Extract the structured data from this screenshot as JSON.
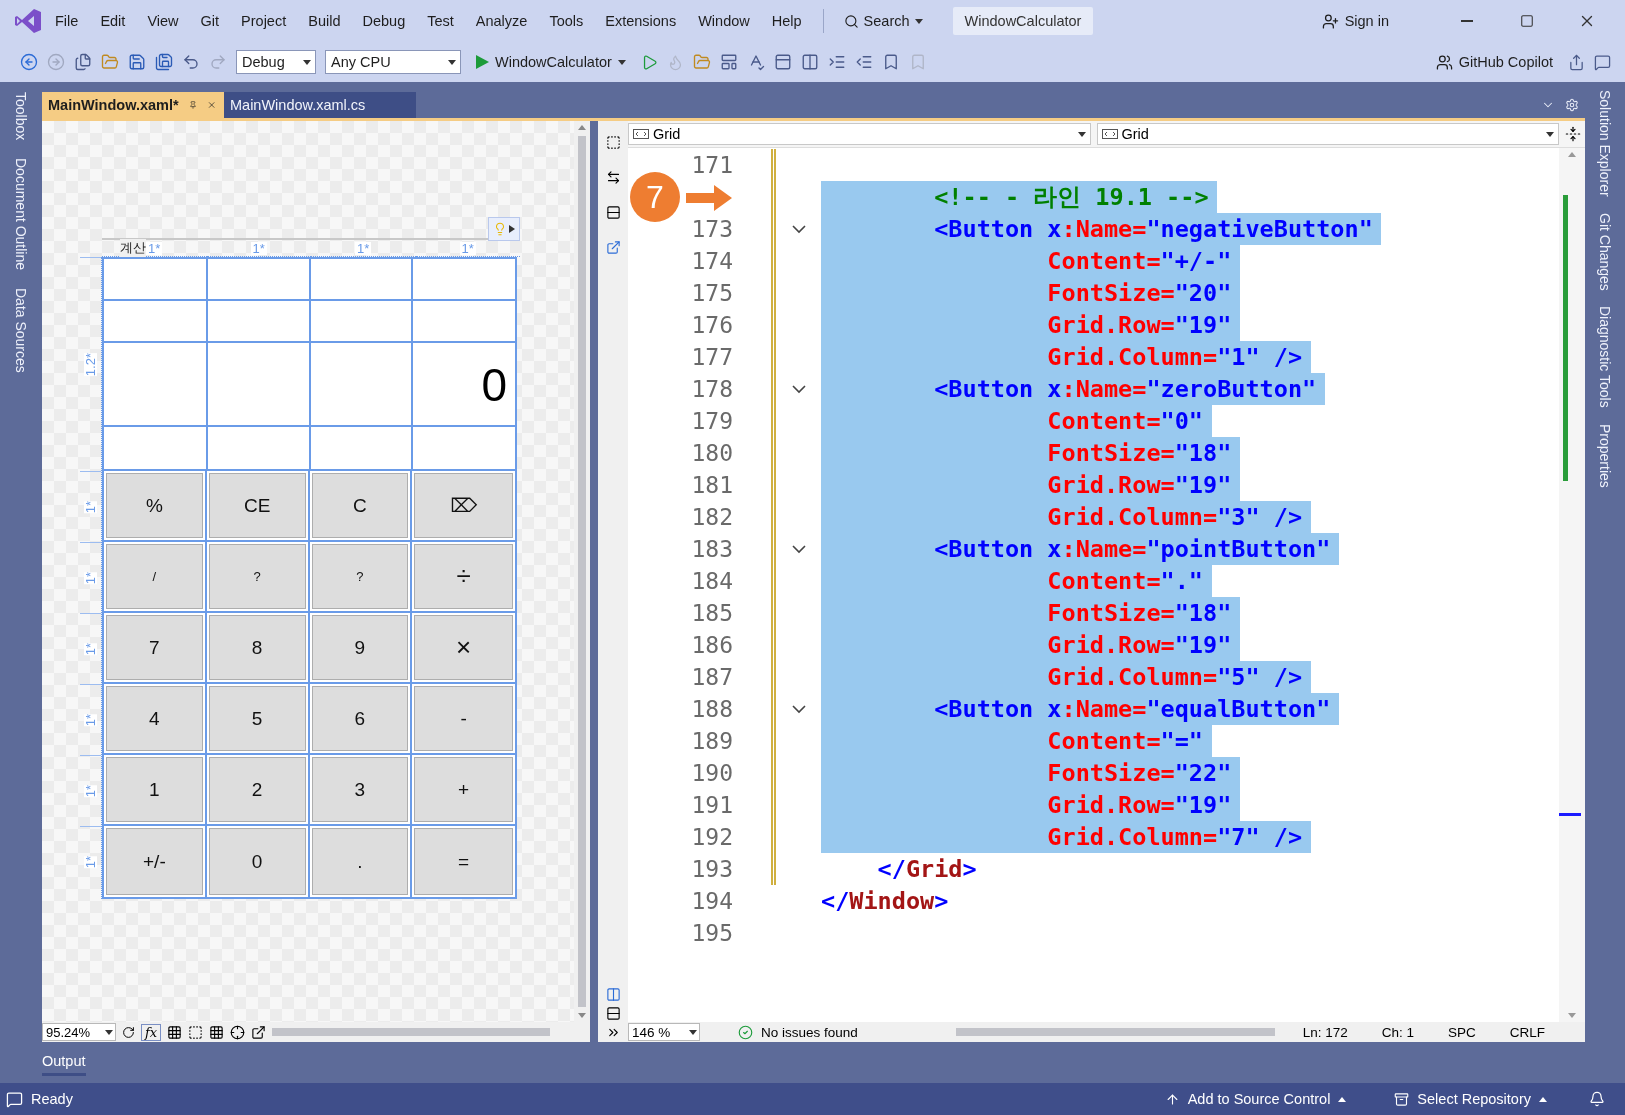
{
  "menu_bar": {
    "menus": [
      "File",
      "Edit",
      "View",
      "Git",
      "Project",
      "Build",
      "Debug",
      "Test",
      "Analyze",
      "Tools",
      "Extensions",
      "Window",
      "Help"
    ],
    "search": "Search",
    "solution_name": "WindowCalculator",
    "sign_in": "Sign in"
  },
  "toolbar": {
    "configuration": "Debug",
    "platform": "Any CPU",
    "start_target": "WindowCalculator",
    "copilot": "GitHub Copilot"
  },
  "left_tool_tabs": [
    "Toolbox",
    "Document Outline",
    "Data Sources"
  ],
  "right_tool_tabs": [
    "Solution Explorer",
    "Git Changes",
    "Diagnostic Tools",
    "Properties"
  ],
  "document_tabs": [
    {
      "label": "MainWindow.xaml*",
      "selected": true
    },
    {
      "label": "MainWindow.xaml.cs",
      "selected": false
    }
  ],
  "designer": {
    "window_title": "계산",
    "column_sizes": [
      "1*",
      "1*",
      "1*",
      "1*"
    ],
    "row_sizes": [
      "1.2*",
      "1*",
      "1*",
      "1*",
      "1*",
      "1*",
      "1*"
    ],
    "display": "0",
    "buttons": [
      {
        "label": "%",
        "kind": "normal"
      },
      {
        "label": "CE",
        "kind": "normal"
      },
      {
        "label": "C",
        "kind": "normal"
      },
      {
        "label": "⌦",
        "kind": "normal"
      },
      {
        "label": "/",
        "kind": "small"
      },
      {
        "label": "?",
        "kind": "small"
      },
      {
        "label": "?",
        "kind": "small"
      },
      {
        "label": "÷",
        "kind": "large"
      },
      {
        "label": "7",
        "kind": "normal"
      },
      {
        "label": "8",
        "kind": "normal"
      },
      {
        "label": "9",
        "kind": "normal"
      },
      {
        "label": "×",
        "kind": "large"
      },
      {
        "label": "4",
        "kind": "normal"
      },
      {
        "label": "5",
        "kind": "normal"
      },
      {
        "label": "6",
        "kind": "normal"
      },
      {
        "label": "-",
        "kind": "normal"
      },
      {
        "label": "1",
        "kind": "normal"
      },
      {
        "label": "2",
        "kind": "normal"
      },
      {
        "label": "3",
        "kind": "normal"
      },
      {
        "label": "+",
        "kind": "normal"
      },
      {
        "label": "+/-",
        "kind": "normal"
      },
      {
        "label": "0",
        "kind": "normal"
      },
      {
        "label": ".",
        "kind": "normal"
      },
      {
        "label": "=",
        "kind": "normal"
      }
    ],
    "zoom": "95.24%",
    "formula_label": "fx"
  },
  "code_editor": {
    "element_dropdowns": [
      "Grid",
      "Grid"
    ],
    "annotation": {
      "label": "7"
    },
    "lines": [
      {
        "number": "171",
        "changed": true,
        "fold": false
      },
      {
        "selected": true,
        "changed": true,
        "fold": false,
        "tokens": [
          {
            "kind": "comment",
            "text": "        <!-- - 라인 19.1 -->"
          }
        ]
      },
      {
        "number": "173",
        "selected": true,
        "changed": true,
        "fold": true,
        "tokens": [
          {
            "kind": "tag",
            "text": "        <Button x"
          },
          {
            "kind": "attr",
            "text": ":Name="
          },
          {
            "kind": "value",
            "text": "\"negativeButton\""
          }
        ]
      },
      {
        "number": "174",
        "selected": true,
        "changed": true,
        "fold": false,
        "tokens": [
          {
            "kind": "attr",
            "text": "                Content="
          },
          {
            "kind": "value",
            "text": "\"+/-\""
          }
        ]
      },
      {
        "number": "175",
        "selected": true,
        "changed": true,
        "fold": false,
        "tokens": [
          {
            "kind": "attr",
            "text": "                FontSize="
          },
          {
            "kind": "value",
            "text": "\"20\""
          }
        ]
      },
      {
        "number": "176",
        "selected": true,
        "changed": true,
        "fold": false,
        "tokens": [
          {
            "kind": "attr",
            "text": "                Grid.Row="
          },
          {
            "kind": "value",
            "text": "\"19\""
          }
        ]
      },
      {
        "number": "177",
        "selected": true,
        "changed": true,
        "fold": false,
        "tokens": [
          {
            "kind": "attr",
            "text": "                Grid.Column="
          },
          {
            "kind": "value",
            "text": "\"1\""
          },
          {
            "kind": "tag",
            "text": " />"
          }
        ]
      },
      {
        "number": "178",
        "selected": true,
        "changed": true,
        "fold": true,
        "tokens": [
          {
            "kind": "tag",
            "text": "        <Button x"
          },
          {
            "kind": "attr",
            "text": ":Name="
          },
          {
            "kind": "value",
            "text": "\"zeroButton\""
          }
        ]
      },
      {
        "number": "179",
        "selected": true,
        "changed": true,
        "fold": false,
        "tokens": [
          {
            "kind": "attr",
            "text": "                Content="
          },
          {
            "kind": "value",
            "text": "\"0\""
          }
        ]
      },
      {
        "number": "180",
        "selected": true,
        "changed": true,
        "fold": false,
        "tokens": [
          {
            "kind": "attr",
            "text": "                FontSize="
          },
          {
            "kind": "value",
            "text": "\"18\""
          }
        ]
      },
      {
        "number": "181",
        "selected": true,
        "changed": true,
        "fold": false,
        "tokens": [
          {
            "kind": "attr",
            "text": "                Grid.Row="
          },
          {
            "kind": "value",
            "text": "\"19\""
          }
        ]
      },
      {
        "number": "182",
        "selected": true,
        "changed": true,
        "fold": false,
        "tokens": [
          {
            "kind": "attr",
            "text": "                Grid.Column="
          },
          {
            "kind": "value",
            "text": "\"3\""
          },
          {
            "kind": "tag",
            "text": " />"
          }
        ]
      },
      {
        "number": "183",
        "selected": true,
        "changed": true,
        "fold": true,
        "tokens": [
          {
            "kind": "tag",
            "text": "        <Button x"
          },
          {
            "kind": "attr",
            "text": ":Name="
          },
          {
            "kind": "value",
            "text": "\"pointButton\""
          }
        ]
      },
      {
        "number": "184",
        "selected": true,
        "changed": true,
        "fold": false,
        "tokens": [
          {
            "kind": "attr",
            "text": "                Content="
          },
          {
            "kind": "value",
            "text": "\".\""
          }
        ]
      },
      {
        "number": "185",
        "selected": true,
        "changed": true,
        "fold": false,
        "tokens": [
          {
            "kind": "attr",
            "text": "                FontSize="
          },
          {
            "kind": "value",
            "text": "\"18\""
          }
        ]
      },
      {
        "number": "186",
        "selected": true,
        "changed": true,
        "fold": false,
        "tokens": [
          {
            "kind": "attr",
            "text": "                Grid.Row="
          },
          {
            "kind": "value",
            "text": "\"19\""
          }
        ]
      },
      {
        "number": "187",
        "selected": true,
        "changed": true,
        "fold": false,
        "tokens": [
          {
            "kind": "attr",
            "text": "                Grid.Column="
          },
          {
            "kind": "value",
            "text": "\"5\""
          },
          {
            "kind": "tag",
            "text": " />"
          }
        ]
      },
      {
        "number": "188",
        "selected": true,
        "changed": true,
        "fold": true,
        "tokens": [
          {
            "kind": "tag",
            "text": "        <Button x"
          },
          {
            "kind": "attr",
            "text": ":Name="
          },
          {
            "kind": "value",
            "text": "\"equalButton\""
          }
        ]
      },
      {
        "number": "189",
        "selected": true,
        "changed": true,
        "fold": false,
        "tokens": [
          {
            "kind": "attr",
            "text": "                Content="
          },
          {
            "kind": "value",
            "text": "\"=\""
          }
        ]
      },
      {
        "number": "190",
        "selected": true,
        "changed": true,
        "fold": false,
        "tokens": [
          {
            "kind": "attr",
            "text": "                FontSize="
          },
          {
            "kind": "value",
            "text": "\"22\""
          }
        ]
      },
      {
        "number": "191",
        "selected": true,
        "changed": true,
        "fold": false,
        "tokens": [
          {
            "kind": "attr",
            "text": "                Grid.Row="
          },
          {
            "kind": "value",
            "text": "\"19\""
          }
        ]
      },
      {
        "number": "192",
        "selected": true,
        "changed": true,
        "fold": false,
        "tokens": [
          {
            "kind": "attr",
            "text": "                Grid.Column="
          },
          {
            "kind": "value",
            "text": "\"7\""
          },
          {
            "kind": "tag",
            "text": " />"
          }
        ]
      },
      {
        "number": "193",
        "selected": false,
        "changed": true,
        "fold": false,
        "tokens": [
          {
            "kind": "tag",
            "text": "    </"
          },
          {
            "kind": "element",
            "text": "Grid"
          },
          {
            "kind": "tag",
            "text": ">"
          }
        ]
      },
      {
        "number": "194",
        "selected": false,
        "changed": false,
        "fold": false,
        "tokens": [
          {
            "kind": "tag",
            "text": "</"
          },
          {
            "kind": "element",
            "text": "Window"
          },
          {
            "kind": "tag",
            "text": ">"
          }
        ]
      },
      {
        "number": "195",
        "changed": false,
        "fold": false
      }
    ],
    "zoom": "146 %",
    "issues": "No issues found",
    "position": [
      "Ln: 172",
      "Ch: 1",
      "SPC",
      "CRLF"
    ]
  },
  "output_tab": "Output",
  "status_bar": {
    "message": "Ready",
    "source_control": "Add to Source Control",
    "repository": "Select Repository"
  }
}
